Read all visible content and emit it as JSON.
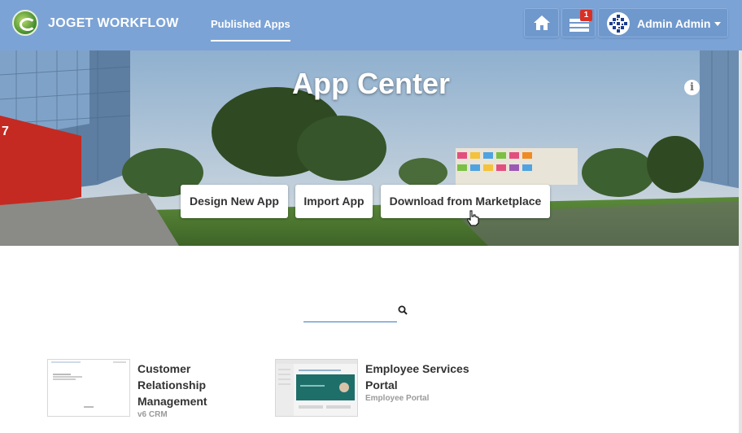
{
  "header": {
    "brand": "JOGET WORKFLOW",
    "nav": {
      "published_apps": "Published Apps"
    },
    "task_count": "1",
    "user_name": "Admin Admin"
  },
  "hero": {
    "title": "App Center",
    "buttons": {
      "design_new_app": "Design New App",
      "import_app": "Import App",
      "download_marketplace": "Download from Marketplace"
    }
  },
  "search": {
    "placeholder": ""
  },
  "apps": [
    {
      "name": "Customer Relationship Management",
      "subtitle": "v6 CRM"
    },
    {
      "name": "Employee Services Portal",
      "subtitle": "Employee Portal"
    }
  ],
  "colors": {
    "header_bg": "#7ba3d6",
    "button_bg": "#6f98cc",
    "badge": "#d93025",
    "search_underline": "#3a78c2"
  },
  "icons": [
    "joget-logo-icon",
    "home-icon",
    "tasks-icon",
    "user-avatar-icon",
    "caret-down-icon",
    "info-icon",
    "search-icon",
    "pointer-cursor-icon"
  ]
}
